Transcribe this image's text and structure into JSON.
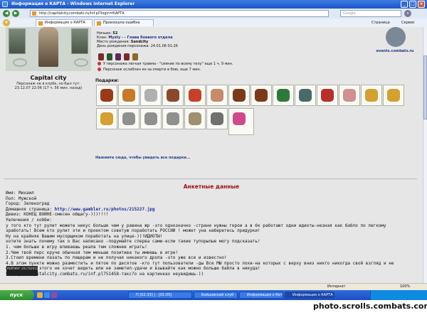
{
  "window": {
    "title": "Информация о КАРТА - Windows Internet Explorer",
    "controls": {
      "minimize": "_",
      "maximize": "□",
      "close": "×"
    }
  },
  "address_bar": {
    "url": "http://capitalcity.combats.ru/inf.pl?login=КАРТА",
    "search_placeholder": "Google"
  },
  "tabs": [
    {
      "label": "Информация о КАРТА",
      "active": true
    },
    {
      "label": "Произошла ошибка",
      "active": false
    }
  ],
  "command_bar": {
    "page_label": "Страница",
    "tools_label": "Сервис"
  },
  "profile": {
    "stats": [
      {
        "label": "Ничьих:",
        "value": "52"
      },
      {
        "label": "Клан:",
        "value": "Mysty - - Глава боевого отдела"
      },
      {
        "label": "Место рождения:",
        "value": "Sandcity"
      },
      {
        "label": "День рождения персонажа:",
        "value": "24.01.06 01:26"
      }
    ],
    "status_lines": [
      "У персонажа легкая травма - \"сияние по всему телу\" еще 1 ч. 9 мин.",
      "Персонаж ослаблен из-за смерти в бою, еще 7 мин."
    ],
    "city": "Capital city",
    "city_note": "Персонаж не в клубе, но был тут: 23.12.07 22:06 (17 ч. 56 мин. назад)",
    "logo_caption": "events.combats.ru"
  },
  "gifts": {
    "label": "Подарки:",
    "link": "Нажмите сюда, чтобы увидеть все подарки...",
    "colors": [
      "#9a3a18",
      "#c87a2a",
      "#b0b0b0",
      "#8a4a2a",
      "#c8402a",
      "#c88a6a",
      "#7a3a1a",
      "#7a3a1a",
      "#2a7a3a",
      "#4a6a6a",
      "#b8302a",
      "#d09090",
      "#d4a030",
      "#d4a030",
      "#d4a030",
      "#909090",
      "#909090",
      "#909090",
      "#a09070",
      "#707070",
      "#d04a8a"
    ]
  },
  "anketa": {
    "title": "Анкетные данные",
    "name": "Имя: Михаил",
    "sex": "Пол: Мужской",
    "city": "Город: Зеленоград",
    "homepage_label": "Домашняя страница:",
    "homepage_url": "http://www.gambler.ru/photos/215227.jpg",
    "motto": "Девиз: КОНЕЦ ВОЙНЕ-смесен общагу-)))!!!!",
    "hobby_label": "Увлечения / хобби:",
    "hobby_lines": [
      "у того кто тут рулит можете никус больше чем у равина жр -это однозначно -стране нужны герои  а в бк работают одни  идиоты-незная как бабло по легкому",
      "зработать! Всем кто рулит эти и проектом советую поработать РОССИИ ! может уна наберетесь придурки!",
      "Ну на крайняк Вашим мусорщиком поработать на улице-))!ИДИОТЫ!",
      "хотите знать почему так о Вас написано -подумайте сперва сами-если такие тупорылые могу подсказать!",
      "1. чем больше в игру вливаешь реала тем сложнее играть!",
      "2.Чем твой перс круче обычная тем меньше позитива ты имеешь в игре!",
      "3.Стоил времени лазать по пещерам и не получая никакого дропа -это уже все и известно!",
      "4.В этом пункте можно разместить и пятое по десятое -кто тут пользователи -ды Все МЫ просто лохи-на которых с верху вниз никто никогда свой взгляд и не",
      "пускал-) кто этого не хочет видеть или не заметил-удачи и взывайте как можно больше бабла в никуда!",
      "5.http://capitalcity.combats.ru/inf.pl751458-такс?о на картинках неувидишь-))"
    ],
    "counter": "РЕЙТИНГ-201762911"
  },
  "statusbar": {
    "zone": "Интернет",
    "zoom": "100%"
  },
  "taskbar": {
    "start": "пуск",
    "tasks": [
      "П [02:33] | - [01:05]",
      "Бойцовский клуб - ...",
      "Информация о Кет...",
      "Информация о КАРТА"
    ]
  },
  "watermark": "photo.scrolls.combats.com"
}
